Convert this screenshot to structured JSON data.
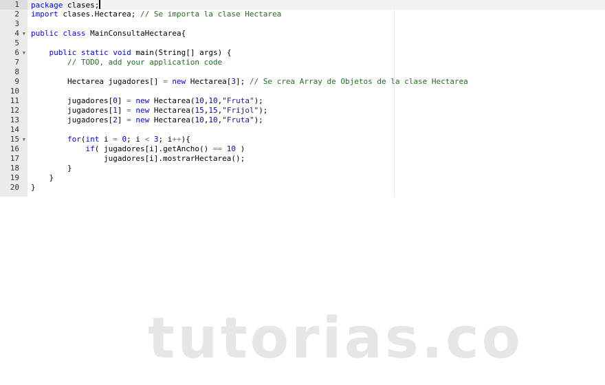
{
  "editor": {
    "active_line": 1,
    "fold_lines": [
      4,
      6,
      15
    ],
    "lines": [
      [
        [
          "keyword",
          "package"
        ],
        [
          "text",
          " clases;"
        ]
      ],
      [
        [
          "keyword",
          "import"
        ],
        [
          "text",
          " clases.Hectarea; "
        ],
        [
          "comment",
          "// Se importa la clase Hectarea"
        ]
      ],
      [],
      [
        [
          "keyword",
          "public"
        ],
        [
          "text",
          " "
        ],
        [
          "keyword",
          "class"
        ],
        [
          "text",
          " MainConsultaHectarea{"
        ]
      ],
      [],
      [
        [
          "text",
          "    "
        ],
        [
          "keyword",
          "public"
        ],
        [
          "text",
          " "
        ],
        [
          "keyword",
          "static"
        ],
        [
          "text",
          " "
        ],
        [
          "keyword",
          "void"
        ],
        [
          "text",
          " main(String[] args) {"
        ]
      ],
      [
        [
          "text",
          "        "
        ],
        [
          "comment",
          "// TODO, add your application code"
        ]
      ],
      [],
      [
        [
          "text",
          "        Hectarea jugadores[] "
        ],
        [
          "operator",
          "="
        ],
        [
          "text",
          " "
        ],
        [
          "keyword",
          "new"
        ],
        [
          "text",
          " Hectarea["
        ],
        [
          "number",
          "3"
        ],
        [
          "text",
          "]; "
        ],
        [
          "comment",
          "// Se crea Array de Objetos de la clase Hectarea"
        ]
      ],
      [],
      [
        [
          "text",
          "        jugadores["
        ],
        [
          "number",
          "0"
        ],
        [
          "text",
          "] "
        ],
        [
          "operator",
          "="
        ],
        [
          "text",
          " "
        ],
        [
          "keyword",
          "new"
        ],
        [
          "text",
          " Hectarea("
        ],
        [
          "number",
          "10"
        ],
        [
          "text",
          ","
        ],
        [
          "number",
          "10"
        ],
        [
          "text",
          ","
        ],
        [
          "string",
          "\"Fruta\""
        ],
        [
          "text",
          ");"
        ]
      ],
      [
        [
          "text",
          "        jugadores["
        ],
        [
          "number",
          "1"
        ],
        [
          "text",
          "] "
        ],
        [
          "operator",
          "="
        ],
        [
          "text",
          " "
        ],
        [
          "keyword",
          "new"
        ],
        [
          "text",
          " Hectarea("
        ],
        [
          "number",
          "15"
        ],
        [
          "text",
          ","
        ],
        [
          "number",
          "15"
        ],
        [
          "text",
          ","
        ],
        [
          "string",
          "\"Frijol\""
        ],
        [
          "text",
          ");"
        ]
      ],
      [
        [
          "text",
          "        jugadores["
        ],
        [
          "number",
          "2"
        ],
        [
          "text",
          "] "
        ],
        [
          "operator",
          "="
        ],
        [
          "text",
          " "
        ],
        [
          "keyword",
          "new"
        ],
        [
          "text",
          " Hectarea("
        ],
        [
          "number",
          "10"
        ],
        [
          "text",
          ","
        ],
        [
          "number",
          "10"
        ],
        [
          "text",
          ","
        ],
        [
          "string",
          "\"Fruta\""
        ],
        [
          "text",
          ");"
        ]
      ],
      [],
      [
        [
          "text",
          "        "
        ],
        [
          "keyword",
          "for"
        ],
        [
          "text",
          "("
        ],
        [
          "keyword",
          "int"
        ],
        [
          "text",
          " i "
        ],
        [
          "operator",
          "="
        ],
        [
          "text",
          " "
        ],
        [
          "number",
          "0"
        ],
        [
          "text",
          "; i "
        ],
        [
          "operator",
          "<"
        ],
        [
          "text",
          " "
        ],
        [
          "number",
          "3"
        ],
        [
          "text",
          "; i"
        ],
        [
          "operator",
          "++"
        ],
        [
          "text",
          "){"
        ]
      ],
      [
        [
          "text",
          "            "
        ],
        [
          "keyword",
          "if"
        ],
        [
          "text",
          "( jugadores[i].getAncho() "
        ],
        [
          "operator",
          "=="
        ],
        [
          "text",
          " "
        ],
        [
          "number",
          "10"
        ],
        [
          "text",
          " )"
        ]
      ],
      [
        [
          "text",
          "                jugadores[i].mostrarHectarea();"
        ]
      ],
      [
        [
          "text",
          "        }"
        ]
      ],
      [
        [
          "text",
          "    }"
        ]
      ],
      [
        [
          "text",
          "}"
        ]
      ]
    ]
  },
  "watermark": "tutorias.co"
}
